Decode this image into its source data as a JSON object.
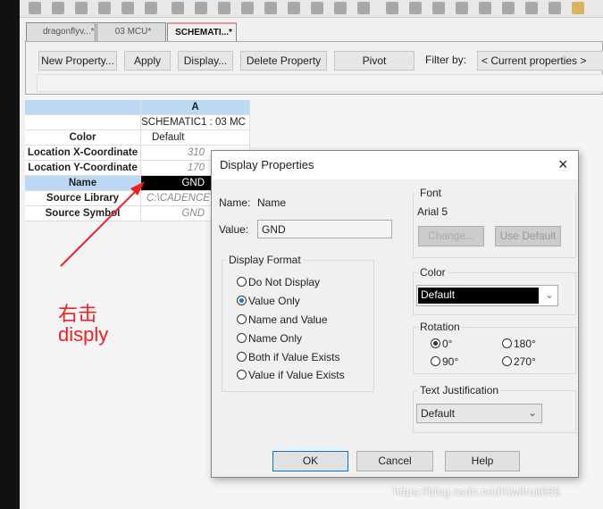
{
  "tabs": [
    {
      "label": "dragonflyv...*"
    },
    {
      "label": "03 MCU*"
    },
    {
      "label": "SCHEMATI...*"
    }
  ],
  "toolbar": {
    "new_property": "New Property...",
    "apply": "Apply",
    "display": "Display...",
    "delete_property": "Delete Property",
    "pivot": "Pivot",
    "filter_label": "Filter by:",
    "filter_value": "< Current properties >"
  },
  "grid": {
    "column": "A",
    "rows": [
      {
        "label": "",
        "value": "SCHEMATIC1 : 03 MC"
      },
      {
        "label": "Color",
        "value": "Default"
      },
      {
        "label": "Location X-Coordinate",
        "value": "310"
      },
      {
        "label": "Location Y-Coordinate",
        "value": "170"
      },
      {
        "label": "Name",
        "value": "GND"
      },
      {
        "label": "Source Library",
        "value": "C:\\CADENCE\\"
      },
      {
        "label": "Source Symbol",
        "value": "GND"
      }
    ]
  },
  "annotation": {
    "line1": "右击",
    "line2": "disply",
    "color": "#e22222"
  },
  "dialog": {
    "title": "Display Properties",
    "close": "×",
    "name_label": "Name:",
    "name_value": "Name",
    "value_label": "Value:",
    "value": "GND",
    "display_format": {
      "label": "Display Format",
      "options": [
        "Do Not Display",
        "Value Only",
        "Name and Value",
        "Name Only",
        "Both if Value Exists",
        "Value if Value Exists"
      ],
      "selected": "Value Only"
    },
    "font": {
      "label": "Font",
      "value": "Arial 5",
      "change": "Change...",
      "use_default": "Use Default"
    },
    "color": {
      "label": "Color",
      "value": "Default"
    },
    "rotation": {
      "label": "Rotation",
      "options": [
        "0°",
        "180°",
        "90°",
        "270°"
      ],
      "selected": "0°"
    },
    "justification": {
      "label": "Text Justification",
      "value": "Default"
    },
    "ok": "OK",
    "cancel": "Cancel",
    "help": "Help"
  },
  "watermark": "https://blog.csdn.net/Kiwifruit666"
}
